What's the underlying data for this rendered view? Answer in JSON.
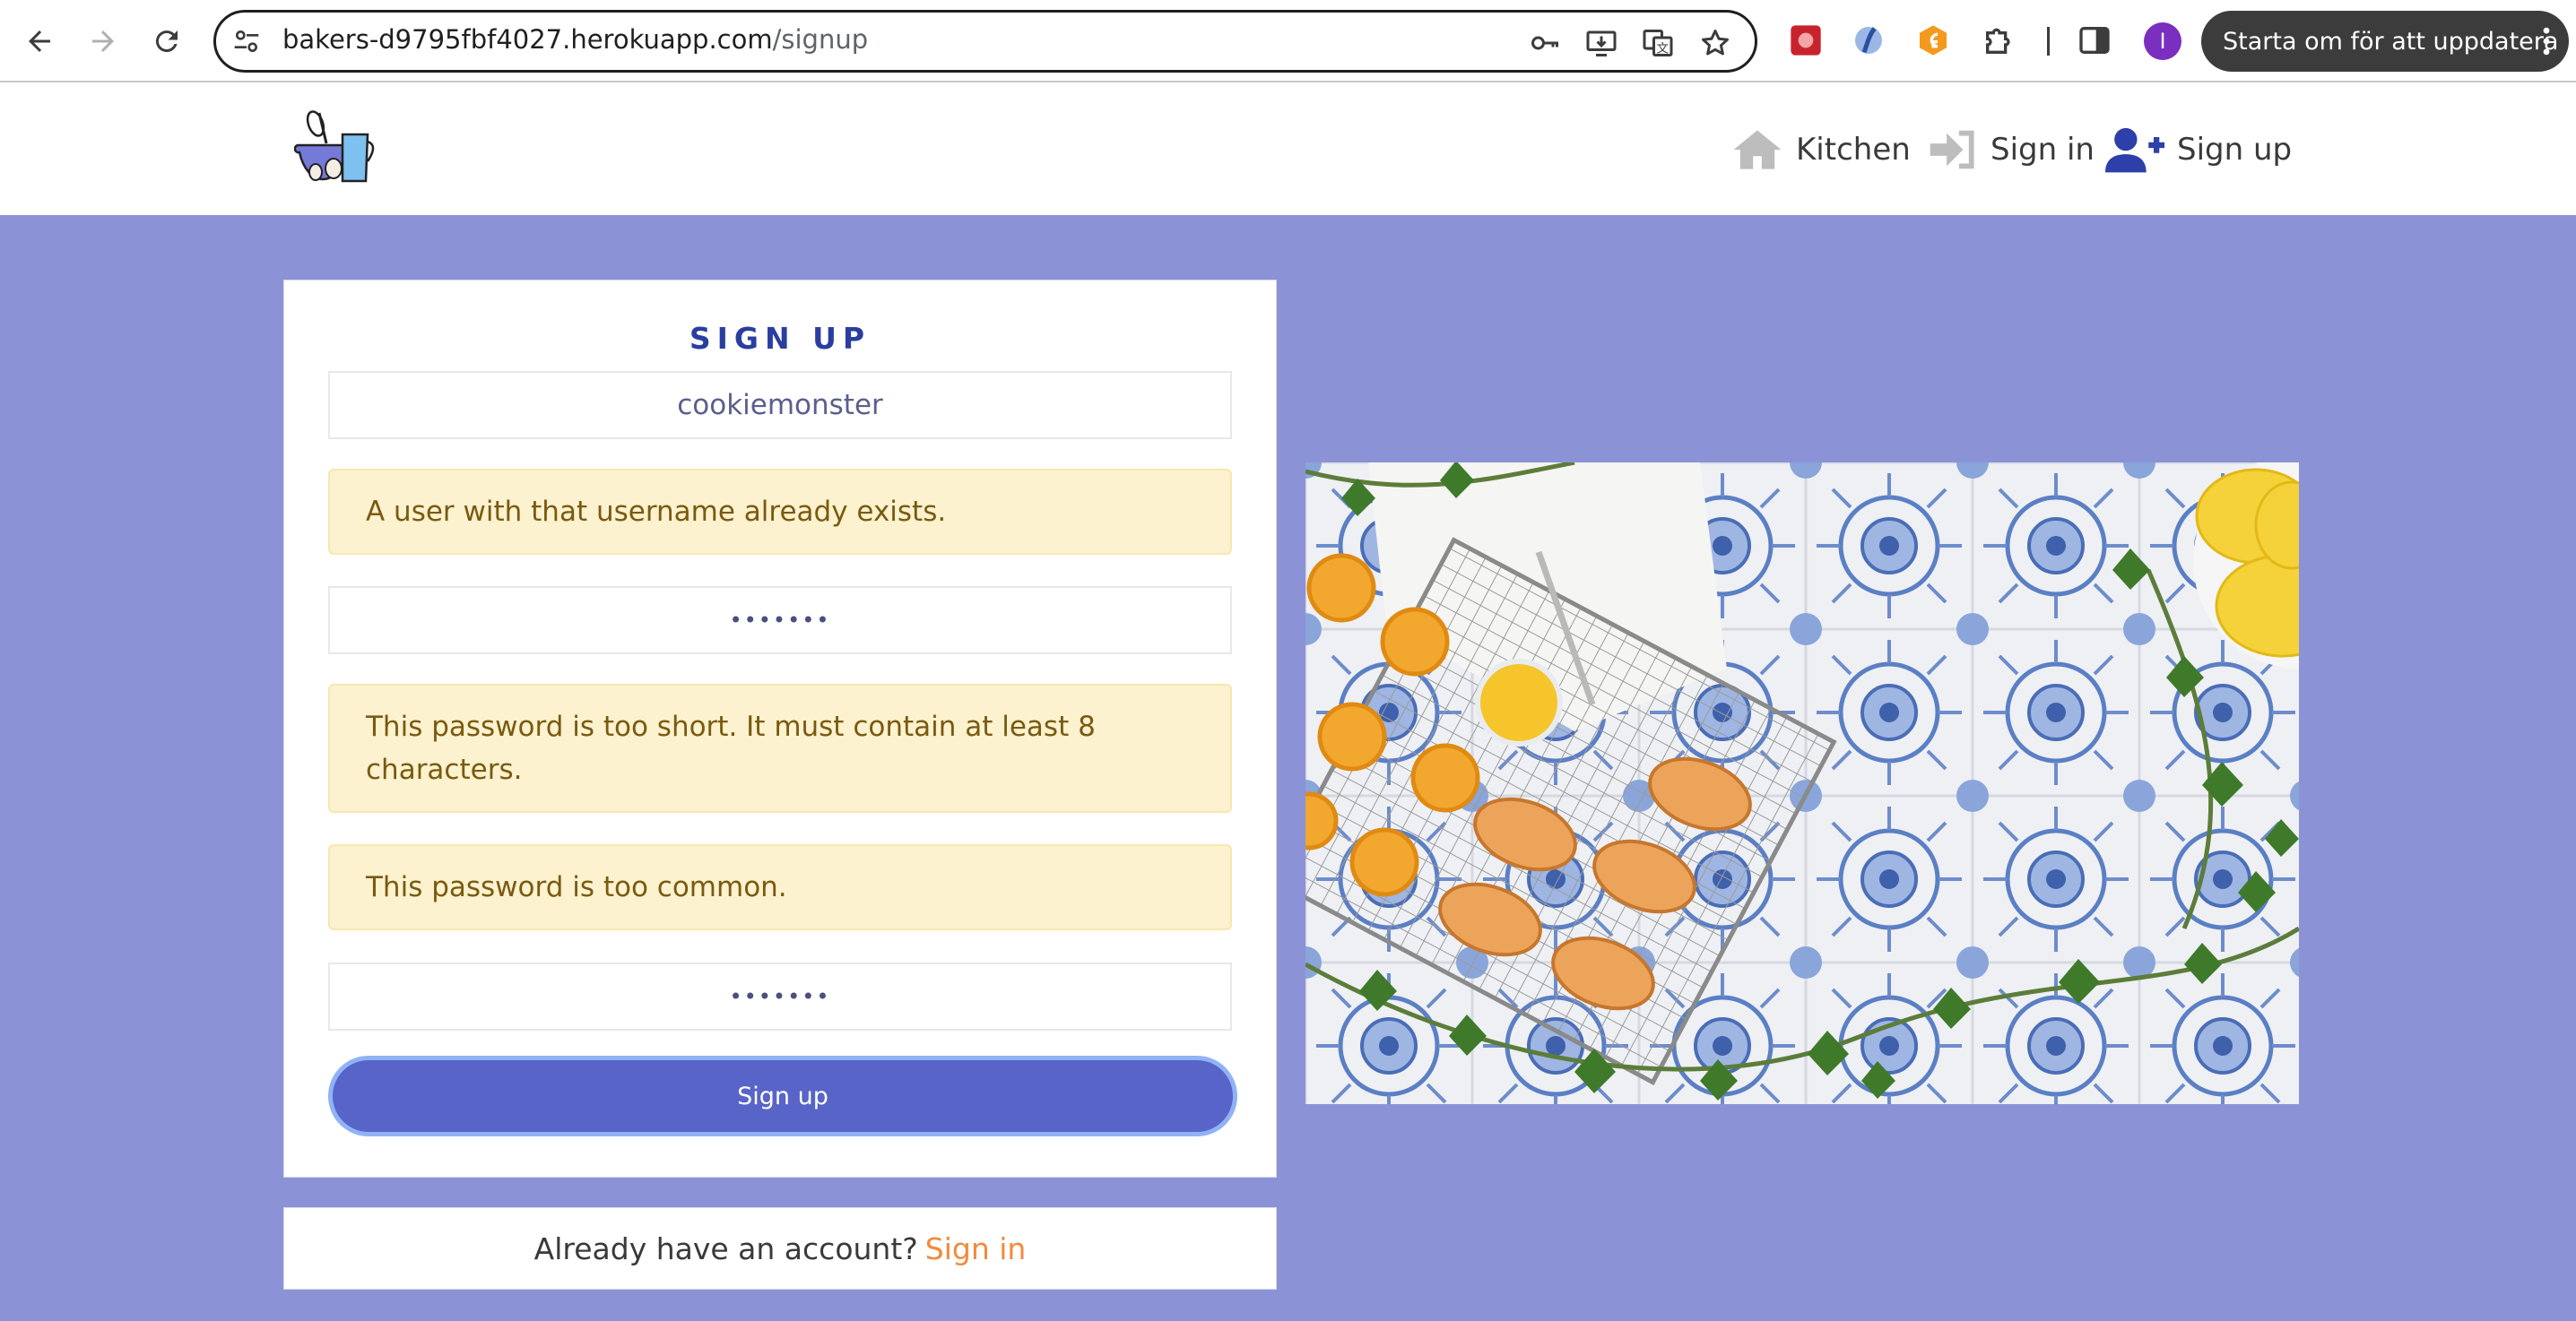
{
  "browser": {
    "url_host": "bakers-d9795fbf4027.herokuapp.com",
    "url_path": "/signup",
    "profile_initial": "I",
    "update_label": "Starta om för att uppdatera"
  },
  "nav": {
    "kitchen": "Kitchen",
    "sign_in": "Sign in",
    "sign_up": "Sign up"
  },
  "form": {
    "heading": "SIGN UP",
    "username_value": "cookiemonster",
    "password_value": "•••••••",
    "password_confirm_value": "•••••••",
    "errors": {
      "username": "A user with that username already exists.",
      "password_short": "This password is too short. It must contain at least 8 characters.",
      "password_common": "This password is too common."
    },
    "submit_label": "Sign up"
  },
  "footer": {
    "prompt": "Already have an account?",
    "link": "Sign in"
  },
  "colors": {
    "page_background": "#8b93d6",
    "heading": "#2a3ea0",
    "button": "#5864c8",
    "link": "#f28a3c",
    "alert_bg": "#fcf2cf"
  }
}
